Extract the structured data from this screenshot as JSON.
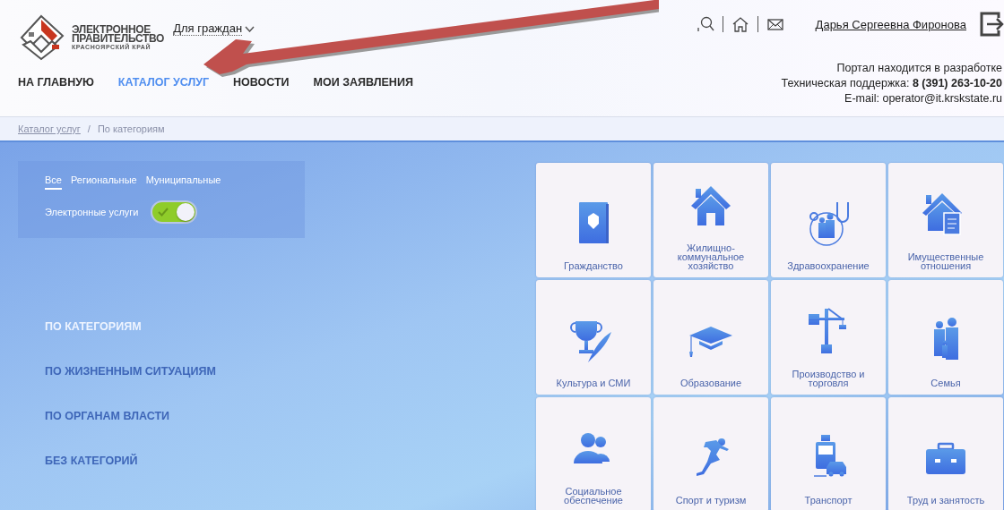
{
  "logo": {
    "title_lines": [
      "ЭЛЕКТРОННОЕ",
      "ПРАВИТЕЛЬСТВО"
    ],
    "subtitle": "КРАСНОЯРСКИЙ КРАЙ"
  },
  "audience_menu": {
    "label": "Для граждан"
  },
  "user_name": "Дарья Сергеевна Фиронова",
  "nav": [
    {
      "label": "НА ГЛАВНУЮ",
      "selected": false
    },
    {
      "label": "КАТАЛОГ УСЛУГ",
      "selected": true
    },
    {
      "label": "НОВОСТИ",
      "selected": false
    },
    {
      "label": "МОИ ЗАЯВЛЕНИЯ",
      "selected": false
    }
  ],
  "info": {
    "status": "Портал находится в разработке",
    "support": "Техническая поддержка: **8 (391) 263-10-20**",
    "email": "E-mail: operator@it.krskstate.ru"
  },
  "breadcrumb": {
    "items": [
      {
        "label": "Каталог услуг",
        "kind": "link"
      },
      {
        "label": "По категориям",
        "kind": "current"
      }
    ],
    "separator": "/"
  },
  "filter": {
    "tabs": [
      {
        "label": "Все",
        "selected": true
      },
      {
        "label": "Региональные",
        "selected": false
      },
      {
        "label": "Муниципальные",
        "selected": false
      }
    ],
    "toggle": {
      "label": "Электронные услуги",
      "on": true
    }
  },
  "views": [
    {
      "label": "ПО КАТЕГОРИЯМ",
      "selected": true
    },
    {
      "label": "ПО ЖИЗНЕННЫМ СИТУАЦИЯМ",
      "selected": false
    },
    {
      "label": "ПО ОРГАНАМ ВЛАСТИ",
      "selected": false
    },
    {
      "label": "БЕЗ КАТЕГОРИЙ",
      "selected": false
    }
  ],
  "categories": [
    {
      "label": "Гражданство"
    },
    {
      "label": "Жилищно-\nкоммунальное\nхозяйство"
    },
    {
      "label": "Здравоохранение"
    },
    {
      "label": "Имущественные\nотношения"
    },
    {
      "label": "Культура и СМИ"
    },
    {
      "label": "Образование"
    },
    {
      "label": "Производство и\nторговля"
    },
    {
      "label": "Семья"
    },
    {
      "label": "Социальное\nобеспечение"
    },
    {
      "label": "Спорт и туризм"
    },
    {
      "label": "Транспорт"
    },
    {
      "label": "Труд и занятость"
    }
  ]
}
